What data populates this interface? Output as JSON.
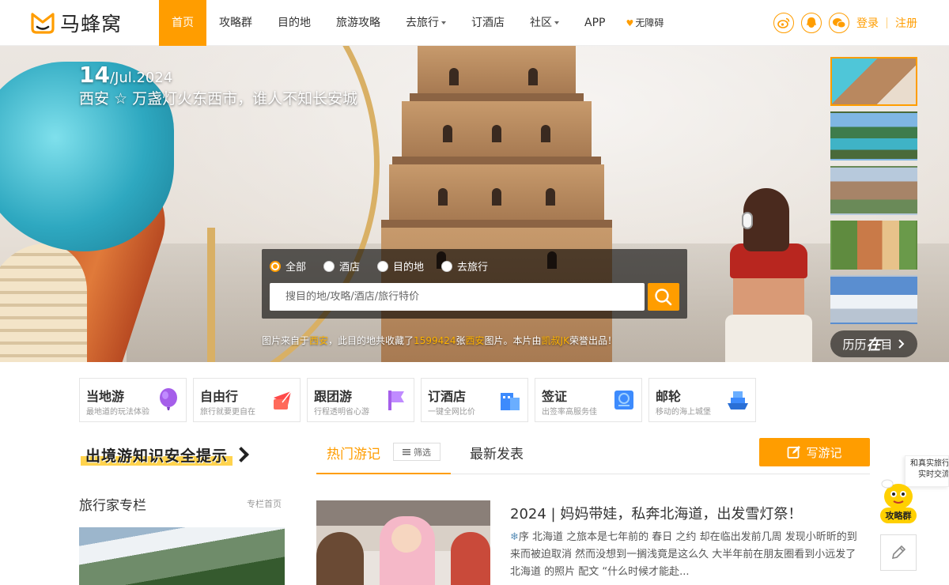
{
  "brand": {
    "name": "马蜂窝",
    "accent": "#ff9d00"
  },
  "nav": {
    "items": [
      {
        "label": "首页",
        "active": true
      },
      {
        "label": "攻略群"
      },
      {
        "label": "目的地"
      },
      {
        "label": "旅游攻略"
      },
      {
        "label": "去旅行",
        "dropdown": true
      },
      {
        "label": "订酒店"
      },
      {
        "label": "社区",
        "dropdown": true
      },
      {
        "label": "APP"
      },
      {
        "label": "无障碍",
        "icon": "heart-icon"
      }
    ]
  },
  "auth": {
    "login": "登录",
    "register": "注册",
    "social_icons": [
      "weibo-icon",
      "qq-icon",
      "wechat-icon"
    ]
  },
  "hero": {
    "day": "14",
    "month_year": "/Jul.2024",
    "title": "西安 ☆ 万盏灯火东西市，谁人不知长安城",
    "thumbnails": [
      "thumb-1",
      "thumb-2",
      "thumb-3",
      "thumb-4",
      "thumb-5"
    ],
    "liliz_button": {
      "pre": "历历",
      "mid": "在",
      "post": "目"
    }
  },
  "search": {
    "options": [
      {
        "label": "全部",
        "checked": true
      },
      {
        "label": "酒店"
      },
      {
        "label": "目的地"
      },
      {
        "label": "去旅行"
      }
    ],
    "placeholder": "搜目的地/攻略/酒店/旅行特价"
  },
  "credit": {
    "p1": "图片来自于",
    "place1": "西安",
    "p2": "，此目的地共收藏了",
    "count": "1599424",
    "p3": "张",
    "place2": "西安",
    "p4": "图片。本片由",
    "author": "凯叔JK",
    "p5": "荣誉出品！"
  },
  "categories": [
    {
      "title": "当地游",
      "sub": "最地道的玩法体验",
      "icon": "balloon-icon"
    },
    {
      "title": "自由行",
      "sub": "旅行就要更自在",
      "icon": "plane-icon"
    },
    {
      "title": "跟团游",
      "sub": "行程透明省心游",
      "icon": "flag-icon"
    },
    {
      "title": "订酒店",
      "sub": "一键全网比价",
      "icon": "hotel-icon"
    },
    {
      "title": "签证",
      "sub": "出签率高服务佳",
      "icon": "visa-icon"
    },
    {
      "title": "邮轮",
      "sub": "移动的海上城堡",
      "icon": "ship-icon"
    }
  ],
  "safety": {
    "label": "出境游知识安全提示"
  },
  "column": {
    "title": "旅行家专栏",
    "link": "专栏首页"
  },
  "tabs": {
    "hot": "热门游记",
    "filter": "筛选",
    "newest": "最新发表",
    "write": "写游记"
  },
  "post": {
    "title": "2024 | 妈妈带娃，私奔北海道，出发雪灯祭！",
    "desc_prefix": "序 北海道 之旅本是七年前的 春日 之约 却在临出发前几周 发现小昕昕的到来而被迫取消 然而没想到一搁浅竟是这么久 大半年前在朋友圈看到小远发了 北海道 的照片 配文 “什么时候才能赴..."
  },
  "float": {
    "card_line1": "和真实旅行",
    "card_line2": "实时交流",
    "badge": "攻略群"
  }
}
